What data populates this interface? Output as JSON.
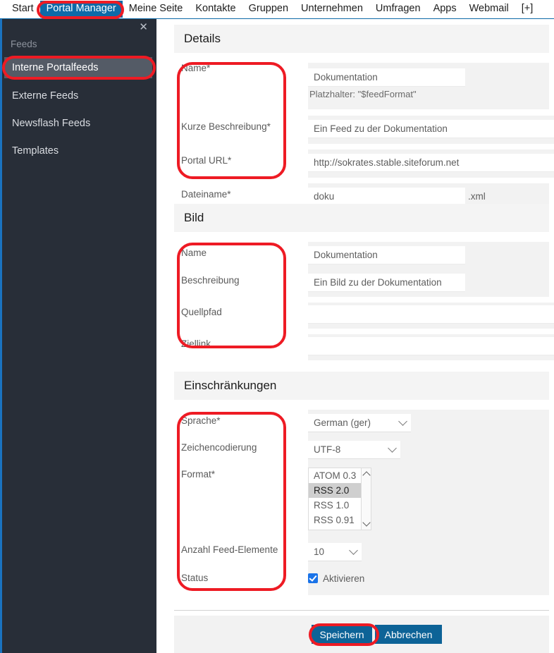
{
  "topnav": {
    "items": [
      {
        "label": "Start",
        "active": false
      },
      {
        "label": "Portal Manager",
        "active": true
      },
      {
        "label": "Meine Seite",
        "active": false
      },
      {
        "label": "Kontakte",
        "active": false
      },
      {
        "label": "Gruppen",
        "active": false
      },
      {
        "label": "Unternehmen",
        "active": false
      },
      {
        "label": "Umfragen",
        "active": false
      },
      {
        "label": "Apps",
        "active": false
      },
      {
        "label": "Webmail",
        "active": false
      },
      {
        "label": "[+]",
        "active": false
      }
    ],
    "active_color": "#0d6aa8"
  },
  "sidebar": {
    "close_icon": "✕",
    "heading": "Feeds",
    "items": [
      {
        "label": "Interne Portalfeeds",
        "selected": true
      },
      {
        "label": "Externe Feeds",
        "selected": false
      },
      {
        "label": "Newsflash Feeds",
        "selected": false
      },
      {
        "label": "Templates",
        "selected": false
      }
    ],
    "bg_color": "#282e38",
    "accent_color": "#1a73c0",
    "selected_color": "#545b66"
  },
  "sections": {
    "details": {
      "title": "Details",
      "fields": {
        "name_label": "Name*",
        "name_value": "Dokumentation",
        "name_hint": "Platzhalter: \"$feedFormat\"",
        "desc_label": "Kurze Beschreibung*",
        "desc_value": "Ein Feed zu der Dokumentation",
        "url_label": "Portal URL*",
        "url_value": "http://sokrates.stable.siteforum.net",
        "filename_label": "Dateiname*",
        "filename_value": "doku",
        "filename_suffix": ".xml"
      }
    },
    "bild": {
      "title": "Bild",
      "fields": {
        "name_label": "Name",
        "name_value": "Dokumentation",
        "desc_label": "Beschreibung",
        "desc_value": "Ein Bild zu der Dokumentation",
        "source_label": "Quellpfad",
        "source_value": "",
        "target_label": "Ziellink",
        "target_value": ""
      }
    },
    "einschraenkungen": {
      "title": "Einschränkungen",
      "fields": {
        "language_label": "Sprache*",
        "language_value": "German (ger)",
        "encoding_label": "Zeichencodierung",
        "encoding_value": "UTF-8",
        "format_label": "Format*",
        "format_options": [
          "ATOM 0.3",
          "RSS 2.0",
          "RSS 1.0",
          "RSS 0.91"
        ],
        "format_selected": "RSS 2.0",
        "count_label": "Anzahl Feed-Elemente",
        "count_value": "10",
        "status_label": "Status",
        "status_checkbox_label": "Aktivieren",
        "status_checked": true
      }
    }
  },
  "footer": {
    "save_label": "Speichern",
    "cancel_label": "Abbrechen",
    "button_color": "#0d6397"
  },
  "annotations": {
    "color": "#ee1b24",
    "marks": [
      {
        "name": "portal-manager-tab"
      },
      {
        "name": "interne-portalfeeds-item"
      },
      {
        "name": "details-labels"
      },
      {
        "name": "bild-labels"
      },
      {
        "name": "einschraenkungen-labels"
      },
      {
        "name": "speichern-button"
      }
    ]
  }
}
